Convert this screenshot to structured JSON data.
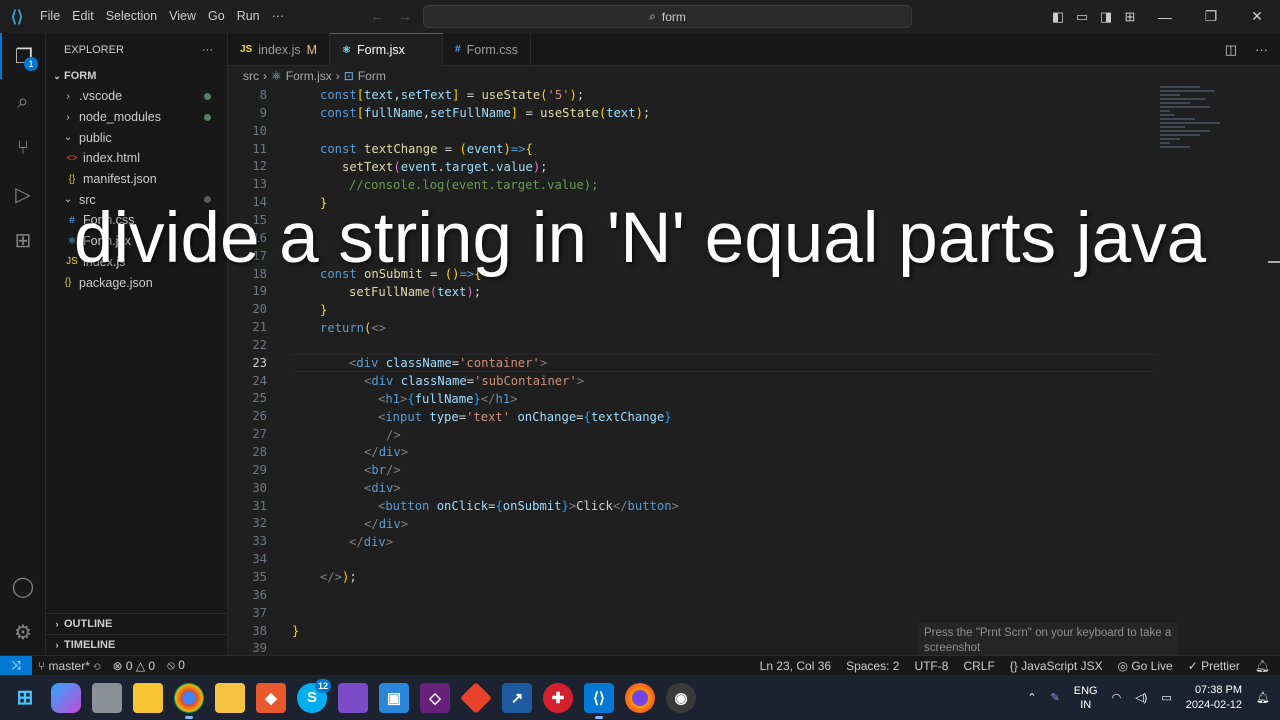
{
  "titlebar": {
    "menu": [
      "File",
      "Edit",
      "Selection",
      "View",
      "Go",
      "Run",
      "···"
    ],
    "search": "form"
  },
  "activity": {
    "explorer_badge": "1"
  },
  "sidebar": {
    "title": "EXPLORER",
    "project": "FORM",
    "items": [
      {
        "label": ".vscode",
        "icon": "chevron-right-icon",
        "indent": 1,
        "dot": "green"
      },
      {
        "label": "node_modules",
        "icon": "chevron-right-icon",
        "indent": 1,
        "dot": "green"
      },
      {
        "label": "public",
        "icon": "chevron-down-icon",
        "indent": 1,
        "dot": ""
      },
      {
        "label": "index.html",
        "icon": "html-file-icon",
        "indent": 2,
        "dot": ""
      },
      {
        "label": "manifest.json",
        "icon": "json-file-icon",
        "indent": 2,
        "dot": ""
      },
      {
        "label": "src",
        "icon": "chevron-down-icon",
        "indent": 1,
        "dot": "gray"
      },
      {
        "label": "Form.css",
        "icon": "css-file-icon",
        "indent": 2,
        "dot": ""
      },
      {
        "label": "Form.jsx",
        "icon": "react-file-icon",
        "indent": 2,
        "dot": ""
      },
      {
        "label": "index.js",
        "icon": "js-file-icon",
        "indent": 2,
        "dot": ""
      },
      {
        "label": "package.json",
        "icon": "json-file-icon",
        "indent": 1,
        "dot": ""
      }
    ],
    "outline": "OUTLINE",
    "timeline": "TIMELINE"
  },
  "tabs": [
    {
      "label": "index.js",
      "icon": "JS",
      "suffix": "M",
      "active": false
    },
    {
      "label": "Form.jsx",
      "icon": "react",
      "suffix": "",
      "active": true
    },
    {
      "label": "Form.css",
      "icon": "#",
      "suffix": "",
      "active": false
    }
  ],
  "breadcrumb": [
    "src",
    "Form.jsx",
    "Form"
  ],
  "editor": {
    "current_line": "23",
    "lines": [
      "8",
      "9",
      "10",
      "11",
      "12",
      "13",
      "14",
      "15",
      "16",
      "17",
      "18",
      "19",
      "20",
      "21",
      "22",
      "23",
      "24",
      "25",
      "26",
      "27",
      "28",
      "29",
      "30",
      "31",
      "32",
      "33",
      "34",
      "35",
      "36",
      "37",
      "38",
      "39"
    ]
  },
  "overlay_title": "divide a string in 'N' equal parts java",
  "tooltip": "Press the \"Prnt Scrn\" on your keyboard to take a screenshot",
  "statusbar": {
    "branch": "master*",
    "errors": "0",
    "warnings": "0",
    "ports": "0",
    "position": "Ln 23, Col 36",
    "spaces": "Spaces: 2",
    "encoding": "UTF-8",
    "eol": "CRLF",
    "language": "JavaScript JSX",
    "golive": "Go Live",
    "prettier": "Prettier"
  },
  "taskbar": {
    "lang_top": "ENG",
    "lang_bottom": "IN",
    "time": "07:38 PM",
    "date": "2024-02-12",
    "skype_badge": "12"
  },
  "colors": {
    "accent": "#0078d4",
    "background": "#1f1f1f",
    "sidebar": "#181818",
    "taskbar": "#1c2230"
  }
}
